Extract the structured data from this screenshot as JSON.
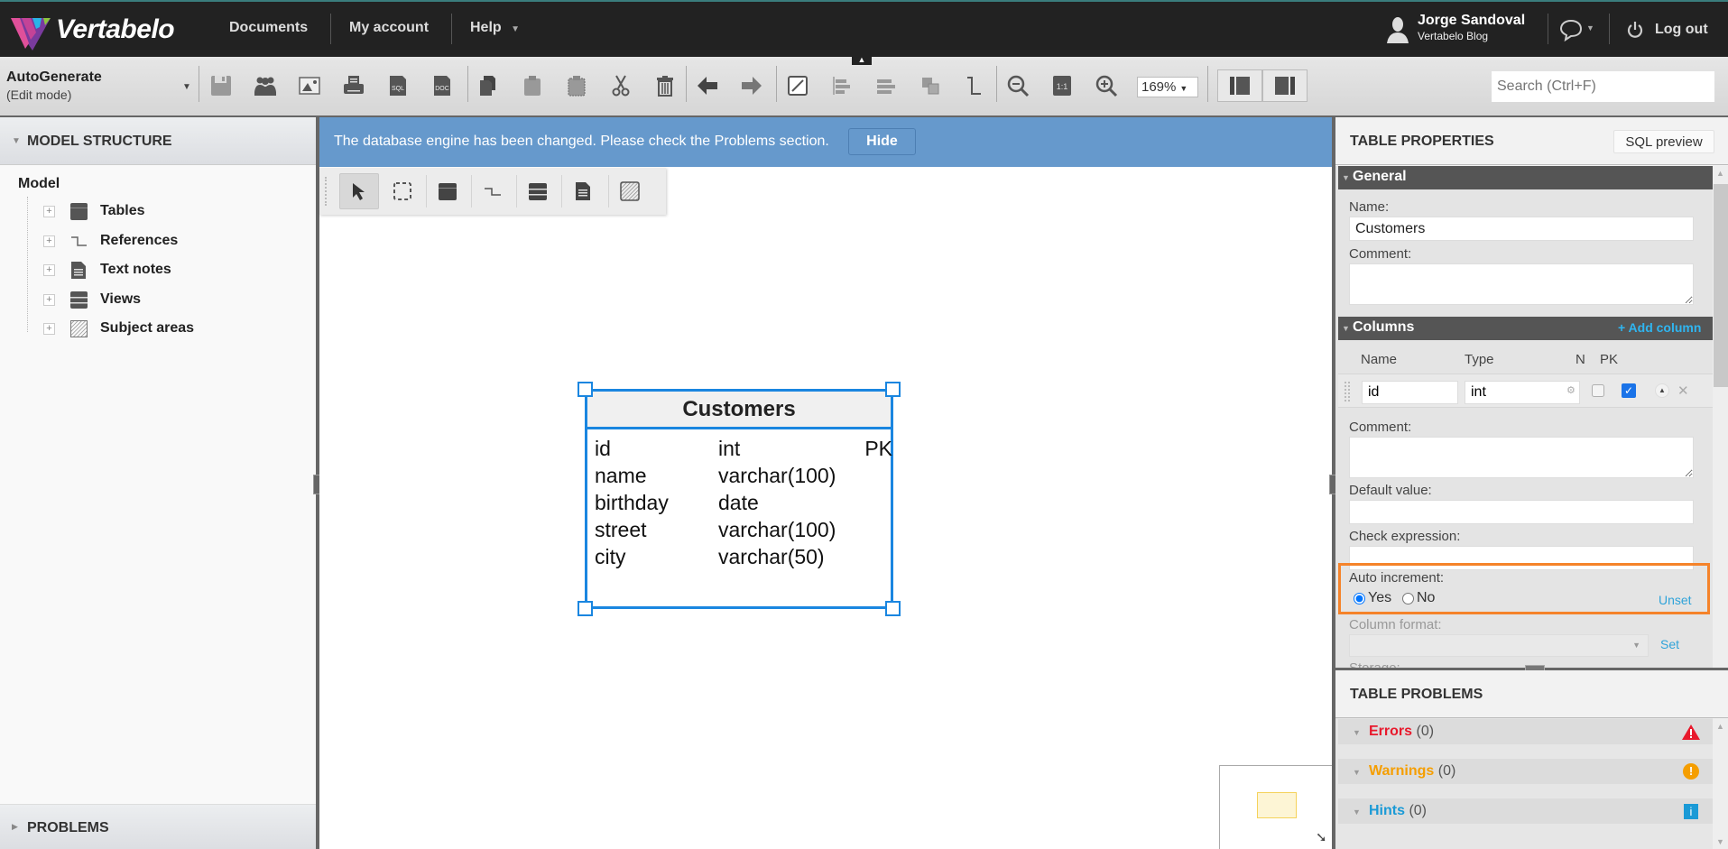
{
  "header": {
    "logo_text": "Vertabelo",
    "nav": [
      {
        "label": "Documents"
      },
      {
        "label": "My account"
      },
      {
        "label": "Help"
      }
    ],
    "user": {
      "name": "Jorge Sandoval",
      "subtitle": "Vertabelo Blog"
    },
    "logout_label": "Log out"
  },
  "toolbar": {
    "document_name": "AutoGenerate",
    "mode": "(Edit mode)",
    "zoom": "169%",
    "search_placeholder": "Search (Ctrl+F)",
    "buttons": [
      "save",
      "share",
      "export-image",
      "print",
      "export-sql",
      "export-doc",
      "copy",
      "paste",
      "paste-special",
      "cut",
      "delete",
      "undo",
      "redo",
      "edit-line",
      "align",
      "distribute",
      "arrange",
      "reference-style",
      "zoom-out",
      "zoom-actual",
      "zoom-in",
      "layout-left-panel",
      "layout-right-panel"
    ],
    "zoom_actual_label": "1:1",
    "sql_icon_label": "SQL",
    "doc_icon_label": "DOC"
  },
  "left_panel": {
    "title": "MODEL STRUCTURE",
    "root": "Model",
    "items": [
      {
        "label": "Tables",
        "icon": "table-icon"
      },
      {
        "label": "References",
        "icon": "reference-icon"
      },
      {
        "label": "Text notes",
        "icon": "note-icon"
      },
      {
        "label": "Views",
        "icon": "view-icon"
      },
      {
        "label": "Subject areas",
        "icon": "subject-area-icon"
      }
    ],
    "problems_title": "PROBLEMS"
  },
  "canvas": {
    "banner_message": "The database engine has been changed. Please check the Problems section.",
    "banner_hide": "Hide",
    "tools": [
      "select",
      "area-select",
      "add-table",
      "add-reference",
      "add-view",
      "add-note",
      "add-subject-area"
    ],
    "entity": {
      "name": "Customers",
      "columns": [
        {
          "name": "id",
          "type": "int",
          "key": "PK"
        },
        {
          "name": "name",
          "type": "varchar(100)",
          "key": ""
        },
        {
          "name": "birthday",
          "type": "date",
          "key": ""
        },
        {
          "name": "street",
          "type": "varchar(100)",
          "key": ""
        },
        {
          "name": "city",
          "type": "varchar(50)",
          "key": ""
        }
      ]
    }
  },
  "right_panel": {
    "title": "TABLE PROPERTIES",
    "sql_preview": "SQL preview",
    "general": {
      "title": "General",
      "name_label": "Name:",
      "name_value": "Customers",
      "comment_label": "Comment:",
      "comment_value": ""
    },
    "columns": {
      "title": "Columns",
      "add_label": "+ Add column",
      "headers": {
        "name": "Name",
        "type": "Type",
        "n": "N",
        "pk": "PK"
      },
      "rows": [
        {
          "name": "id",
          "type": "int",
          "nullable": false,
          "pk": true
        }
      ],
      "comment_label": "Comment:",
      "default_label": "Default value:",
      "check_label": "Check expression:",
      "auto_increment_label": "Auto increment:",
      "auto_yes": "Yes",
      "auto_no": "No",
      "auto_selected": "Yes",
      "unset_label": "Unset",
      "column_format_label": "Column format:",
      "set_label": "Set",
      "storage_label": "Storage:"
    },
    "highlight_color": "#f5832a",
    "problems": {
      "title": "TABLE PROBLEMS",
      "errors_label": "Errors",
      "errors_count": "(0)",
      "warnings_label": "Warnings",
      "warnings_count": "(0)",
      "hints_label": "Hints",
      "hints_count": "(0)",
      "colors": {
        "errors": "#e8192c",
        "warnings": "#f59e00",
        "hints": "#1a9ad6"
      }
    }
  }
}
